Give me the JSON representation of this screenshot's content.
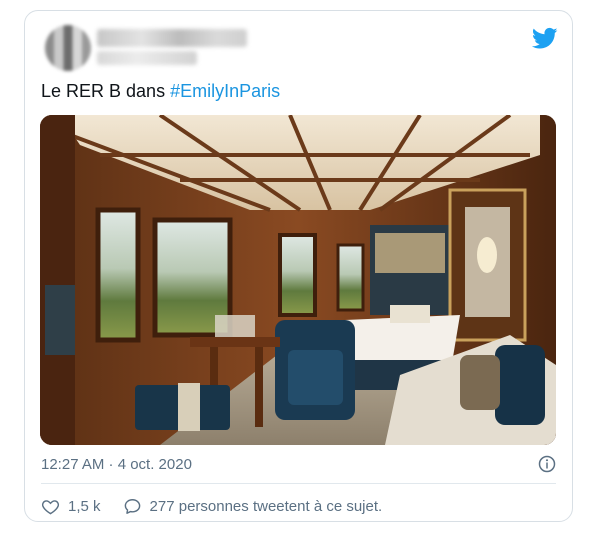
{
  "tweet": {
    "text_prefix": "Le RER B dans ",
    "hashtag": "#EmilyInParis",
    "timestamp": "12:27 AM · 4 oct. 2020",
    "likes": "1,5 k",
    "retweet_text": "277 personnes tweetent à ce sujet.",
    "image_alt": "Intérieur de cabine Orient Express",
    "hashtag_color": "#1b95e0",
    "brand_color": "#1da1f2"
  },
  "icons": {
    "brand": "twitter-bird-icon",
    "info": "info-icon",
    "like": "heart-icon",
    "discussion": "speech-bubble-icon"
  }
}
